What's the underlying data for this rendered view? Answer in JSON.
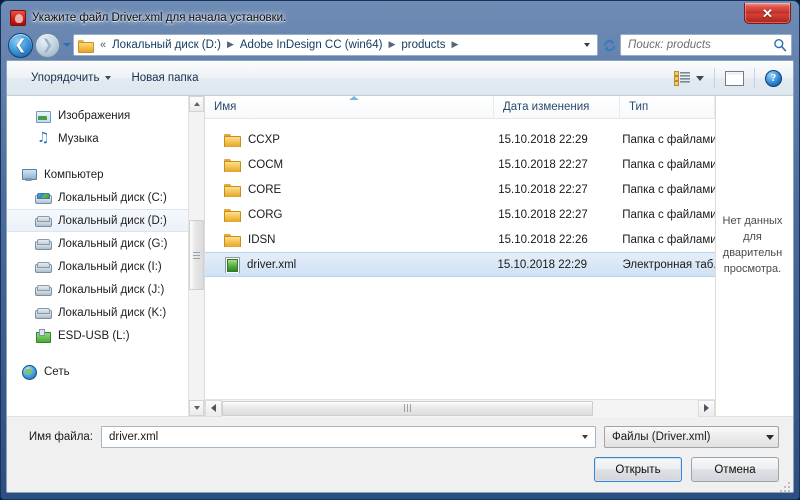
{
  "window": {
    "title": "Укажите файл Driver.xml для начала установки.",
    "app_icon": "red-installer-icon",
    "close_label": "✕",
    "accent_color": "#2c4e80",
    "selection_color": "#cfe2f5"
  },
  "address_bar": {
    "back_icon": "back-arrow-icon",
    "forward_icon": "forward-arrow-icon",
    "history_icon": "chevron-down-icon",
    "folder_icon": "folder-icon",
    "overflow": "«",
    "crumbs": [
      "Локальный диск (D:)",
      "Adobe InDesign CC (win64)",
      "products"
    ],
    "separator": "▶",
    "dropdown_icon": "chevron-down-icon",
    "refresh_icon": "refresh-icon"
  },
  "search": {
    "placeholder": "Поиск: products",
    "icon": "search-icon"
  },
  "command_bar": {
    "organize_label": "Упорядочить",
    "new_folder_label": "Новая папка",
    "view_icon": "view-list-icon",
    "view_dropdown_icon": "chevron-down-icon",
    "preview_pane_icon": "preview-pane-icon",
    "help_icon": "help-icon",
    "help_glyph": "?"
  },
  "sidebar": {
    "items": [
      {
        "label": "Изображения",
        "icon": "pictures-icon",
        "level": "indent",
        "selected": false
      },
      {
        "label": "Музыка",
        "icon": "music-icon",
        "level": "indent",
        "selected": false
      },
      {
        "label": "Компьютер",
        "icon": "computer-icon",
        "level": "root",
        "selected": false
      },
      {
        "label": "Локальный диск (C:)",
        "icon": "drive-system-icon",
        "level": "indent",
        "selected": false
      },
      {
        "label": "Локальный диск (D:)",
        "icon": "drive-icon",
        "level": "indent",
        "selected": true
      },
      {
        "label": "Локальный диск (G:)",
        "icon": "drive-icon",
        "level": "indent",
        "selected": false
      },
      {
        "label": "Локальный диск (I:)",
        "icon": "drive-icon",
        "level": "indent",
        "selected": false
      },
      {
        "label": "Локальный диск (J:)",
        "icon": "drive-icon",
        "level": "indent",
        "selected": false
      },
      {
        "label": "Локальный диск (K:)",
        "icon": "drive-icon",
        "level": "indent",
        "selected": false
      },
      {
        "label": "ESD-USB (L:)",
        "icon": "usb-drive-icon",
        "level": "indent",
        "selected": false
      },
      {
        "label": "Сеть",
        "icon": "network-icon",
        "level": "root",
        "selected": false
      }
    ]
  },
  "file_list": {
    "columns": [
      "Имя",
      "Дата изменения",
      "Тип"
    ],
    "sort_column": "Имя",
    "rows": [
      {
        "name": "CCXP",
        "date": "15.10.2018 22:29",
        "type": "Папка с файлами",
        "icon": "folder-icon",
        "selected": false
      },
      {
        "name": "COCM",
        "date": "15.10.2018 22:27",
        "type": "Папка с файлами",
        "icon": "folder-icon",
        "selected": false
      },
      {
        "name": "CORE",
        "date": "15.10.2018 22:27",
        "type": "Папка с файлами",
        "icon": "folder-icon",
        "selected": false
      },
      {
        "name": "CORG",
        "date": "15.10.2018 22:27",
        "type": "Папка с файлами",
        "icon": "folder-icon",
        "selected": false
      },
      {
        "name": "IDSN",
        "date": "15.10.2018 22:26",
        "type": "Папка с файлами",
        "icon": "folder-icon",
        "selected": false
      },
      {
        "name": "driver.xml",
        "date": "15.10.2018 22:29",
        "type": "Электронная таб.",
        "icon": "xml-file-icon",
        "selected": true
      }
    ]
  },
  "preview_pane": {
    "text": "Нет данных\nдля\nдварительн\nпросмотра."
  },
  "bottom": {
    "filename_label": "Имя файла:",
    "filename_value": "driver.xml",
    "filename_dropdown_icon": "chevron-down-icon",
    "filetype_value": "Файлы (Driver.xml)",
    "filetype_dropdown_icon": "chevron-down-icon",
    "open_label": "Открыть",
    "cancel_label": "Отмена"
  }
}
